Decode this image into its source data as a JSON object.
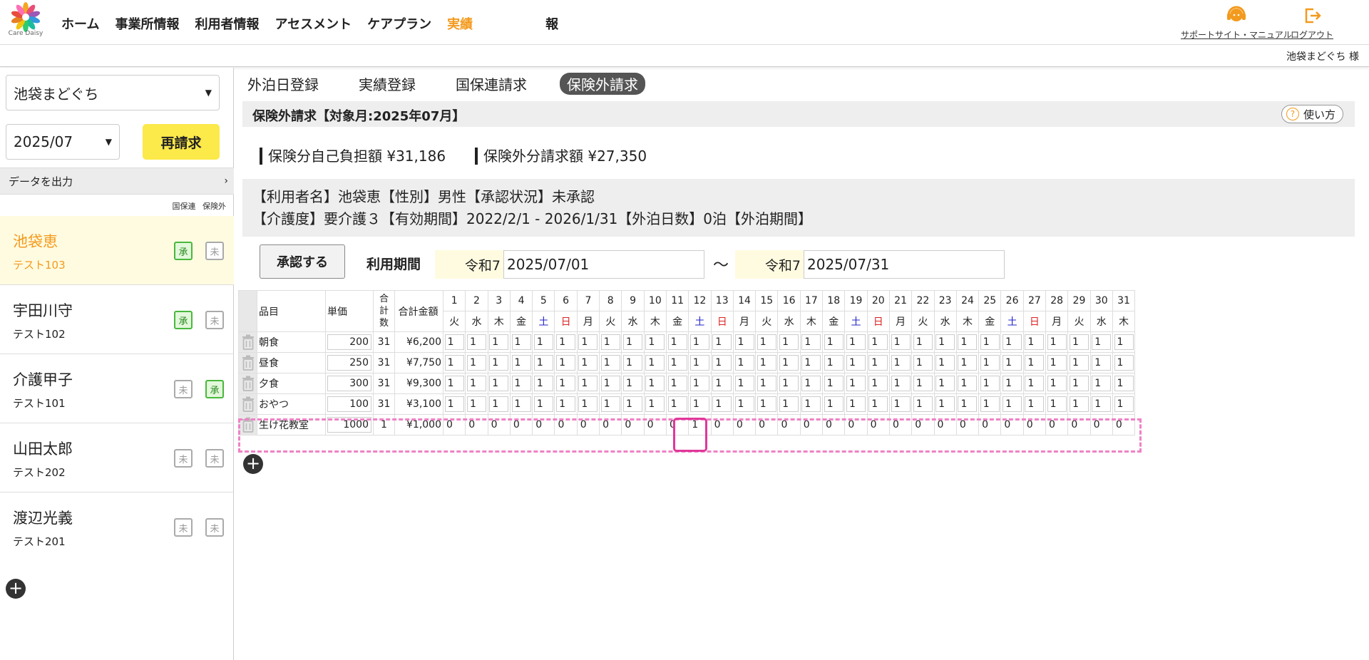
{
  "header": {
    "logo_text": "Care Daisy",
    "nav": [
      {
        "label": "ホーム",
        "active": false
      },
      {
        "label": "事業所情報",
        "active": false
      },
      {
        "label": "利用者情報",
        "active": false
      },
      {
        "label": "アセスメント",
        "active": false
      },
      {
        "label": "ケアプラン",
        "active": false
      },
      {
        "label": "実績",
        "active": true
      },
      {
        "label": "報",
        "active": false
      }
    ],
    "support_label": "サポートサイト・マニュアル",
    "logout_label": "ログアウト",
    "user_name": "池袋まどぐち 様"
  },
  "sidebar": {
    "office_select": "池袋まどぐち",
    "month_select": "2025/07",
    "reclaim_button": "再請求",
    "export_label": "データを出力",
    "col_nhi": "国保連",
    "col_uninsured": "保険外",
    "persons": [
      {
        "name": "池袋恵",
        "id": "テスト103",
        "nhi": "承",
        "nhi_ok": true,
        "uninsured": "未",
        "uninsured_ok": false,
        "selected": true
      },
      {
        "name": "宇田川守",
        "id": "テスト102",
        "nhi": "承",
        "nhi_ok": true,
        "uninsured": "未",
        "uninsured_ok": false,
        "selected": false
      },
      {
        "name": "介護甲子",
        "id": "テスト101",
        "nhi": "未",
        "nhi_ok": false,
        "uninsured": "承",
        "uninsured_ok": true,
        "selected": false
      },
      {
        "name": "山田太郎",
        "id": "テスト202",
        "nhi": "未",
        "nhi_ok": false,
        "uninsured": "未",
        "uninsured_ok": false,
        "selected": false
      },
      {
        "name": "渡辺光義",
        "id": "テスト201",
        "nhi": "未",
        "nhi_ok": false,
        "uninsured": "未",
        "uninsured_ok": false,
        "selected": false
      }
    ],
    "add_symbol": "+"
  },
  "main": {
    "tabs": [
      {
        "label": "外泊日登録",
        "active": false
      },
      {
        "label": "実績登録",
        "active": false
      },
      {
        "label": "国保連請求",
        "active": false
      },
      {
        "label": "保険外請求",
        "active": true
      }
    ],
    "title": "保険外請求【対象月:2025年07月】",
    "howto_label": "使い方",
    "summary_insured": "保険分自己負担額 ¥31,186",
    "summary_uninsured": "保険外分請求額 ¥27,350",
    "info_line1": "【利用者名】池袋恵【性別】男性【承認状況】未承認",
    "info_line2": "【介護度】要介護３【有効期間】2022/2/1 - 2026/1/31【外泊日数】0泊【外泊期間】",
    "approve_button": "承認する",
    "period_label": "利用期間",
    "era_start": "令和7",
    "date_start": "2025/07/01",
    "tilde": "〜",
    "era_end": "令和7",
    "date_end": "2025/07/31",
    "table": {
      "col_item": "品目",
      "col_price": "単価",
      "col_count": "合計数",
      "col_amount": "合計金額",
      "days": [
        1,
        2,
        3,
        4,
        5,
        6,
        7,
        8,
        9,
        10,
        11,
        12,
        13,
        14,
        15,
        16,
        17,
        18,
        19,
        20,
        21,
        22,
        23,
        24,
        25,
        26,
        27,
        28,
        29,
        30,
        31
      ],
      "dow": [
        "火",
        "水",
        "木",
        "金",
        "土",
        "日",
        "月",
        "火",
        "水",
        "木",
        "金",
        "土",
        "日",
        "月",
        "火",
        "水",
        "木",
        "金",
        "土",
        "日",
        "月",
        "火",
        "水",
        "木",
        "金",
        "土",
        "日",
        "月",
        "火",
        "水",
        "木"
      ],
      "rows": [
        {
          "item": "朝食",
          "price": "200",
          "count": "31",
          "amount": "¥6,200",
          "values": [
            "1",
            "1",
            "1",
            "1",
            "1",
            "1",
            "1",
            "1",
            "1",
            "1",
            "1",
            "1",
            "1",
            "1",
            "1",
            "1",
            "1",
            "1",
            "1",
            "1",
            "1",
            "1",
            "1",
            "1",
            "1",
            "1",
            "1",
            "1",
            "1",
            "1",
            "1"
          ],
          "boxed": true
        },
        {
          "item": "昼食",
          "price": "250",
          "count": "31",
          "amount": "¥7,750",
          "values": [
            "1",
            "1",
            "1",
            "1",
            "1",
            "1",
            "1",
            "1",
            "1",
            "1",
            "1",
            "1",
            "1",
            "1",
            "1",
            "1",
            "1",
            "1",
            "1",
            "1",
            "1",
            "1",
            "1",
            "1",
            "1",
            "1",
            "1",
            "1",
            "1",
            "1",
            "1"
          ],
          "boxed": true
        },
        {
          "item": "夕食",
          "price": "300",
          "count": "31",
          "amount": "¥9,300",
          "values": [
            "1",
            "1",
            "1",
            "1",
            "1",
            "1",
            "1",
            "1",
            "1",
            "1",
            "1",
            "1",
            "1",
            "1",
            "1",
            "1",
            "1",
            "1",
            "1",
            "1",
            "1",
            "1",
            "1",
            "1",
            "1",
            "1",
            "1",
            "1",
            "1",
            "1",
            "1"
          ],
          "boxed": true
        },
        {
          "item": "おやつ",
          "price": "100",
          "count": "31",
          "amount": "¥3,100",
          "values": [
            "1",
            "1",
            "1",
            "1",
            "1",
            "1",
            "1",
            "1",
            "1",
            "1",
            "1",
            "1",
            "1",
            "1",
            "1",
            "1",
            "1",
            "1",
            "1",
            "1",
            "1",
            "1",
            "1",
            "1",
            "1",
            "1",
            "1",
            "1",
            "1",
            "1",
            "1"
          ],
          "boxed": true
        },
        {
          "item": "生け花教室",
          "price": "1000",
          "count": "1",
          "amount": "¥1,000",
          "values": [
            "0",
            "0",
            "0",
            "0",
            "0",
            "0",
            "0",
            "0",
            "0",
            "0",
            "0",
            "1",
            "0",
            "0",
            "0",
            "0",
            "0",
            "0",
            "0",
            "0",
            "0",
            "0",
            "0",
            "0",
            "0",
            "0",
            "0",
            "0",
            "0",
            "0",
            "0"
          ],
          "boxed": false
        }
      ]
    },
    "add_symbol": "+"
  },
  "colors": {
    "accent_orange": "#f39a1e",
    "reclaim_yellow": "#fce94a",
    "approved_green": "#48b83c",
    "saturday_blue": "#2323c8",
    "sunday_red": "#dd2222",
    "highlight_pink": "#e0389a"
  }
}
